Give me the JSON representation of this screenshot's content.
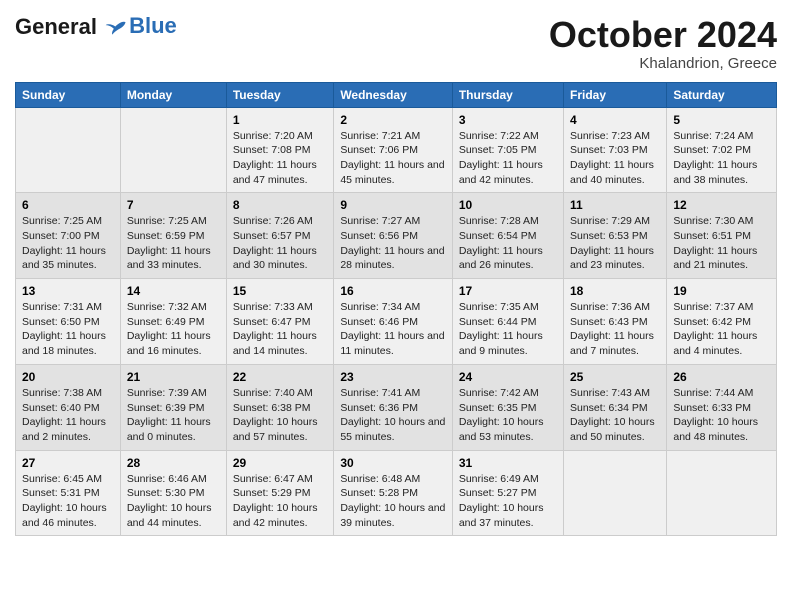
{
  "header": {
    "logo_line1": "General",
    "logo_line2": "Blue",
    "month": "October 2024",
    "location": "Khalandrion, Greece"
  },
  "weekdays": [
    "Sunday",
    "Monday",
    "Tuesday",
    "Wednesday",
    "Thursday",
    "Friday",
    "Saturday"
  ],
  "weeks": [
    [
      {
        "day": "",
        "sunrise": "",
        "sunset": "",
        "daylight": ""
      },
      {
        "day": "",
        "sunrise": "",
        "sunset": "",
        "daylight": ""
      },
      {
        "day": "1",
        "sunrise": "Sunrise: 7:20 AM",
        "sunset": "Sunset: 7:08 PM",
        "daylight": "Daylight: 11 hours and 47 minutes."
      },
      {
        "day": "2",
        "sunrise": "Sunrise: 7:21 AM",
        "sunset": "Sunset: 7:06 PM",
        "daylight": "Daylight: 11 hours and 45 minutes."
      },
      {
        "day": "3",
        "sunrise": "Sunrise: 7:22 AM",
        "sunset": "Sunset: 7:05 PM",
        "daylight": "Daylight: 11 hours and 42 minutes."
      },
      {
        "day": "4",
        "sunrise": "Sunrise: 7:23 AM",
        "sunset": "Sunset: 7:03 PM",
        "daylight": "Daylight: 11 hours and 40 minutes."
      },
      {
        "day": "5",
        "sunrise": "Sunrise: 7:24 AM",
        "sunset": "Sunset: 7:02 PM",
        "daylight": "Daylight: 11 hours and 38 minutes."
      }
    ],
    [
      {
        "day": "6",
        "sunrise": "Sunrise: 7:25 AM",
        "sunset": "Sunset: 7:00 PM",
        "daylight": "Daylight: 11 hours and 35 minutes."
      },
      {
        "day": "7",
        "sunrise": "Sunrise: 7:25 AM",
        "sunset": "Sunset: 6:59 PM",
        "daylight": "Daylight: 11 hours and 33 minutes."
      },
      {
        "day": "8",
        "sunrise": "Sunrise: 7:26 AM",
        "sunset": "Sunset: 6:57 PM",
        "daylight": "Daylight: 11 hours and 30 minutes."
      },
      {
        "day": "9",
        "sunrise": "Sunrise: 7:27 AM",
        "sunset": "Sunset: 6:56 PM",
        "daylight": "Daylight: 11 hours and 28 minutes."
      },
      {
        "day": "10",
        "sunrise": "Sunrise: 7:28 AM",
        "sunset": "Sunset: 6:54 PM",
        "daylight": "Daylight: 11 hours and 26 minutes."
      },
      {
        "day": "11",
        "sunrise": "Sunrise: 7:29 AM",
        "sunset": "Sunset: 6:53 PM",
        "daylight": "Daylight: 11 hours and 23 minutes."
      },
      {
        "day": "12",
        "sunrise": "Sunrise: 7:30 AM",
        "sunset": "Sunset: 6:51 PM",
        "daylight": "Daylight: 11 hours and 21 minutes."
      }
    ],
    [
      {
        "day": "13",
        "sunrise": "Sunrise: 7:31 AM",
        "sunset": "Sunset: 6:50 PM",
        "daylight": "Daylight: 11 hours and 18 minutes."
      },
      {
        "day": "14",
        "sunrise": "Sunrise: 7:32 AM",
        "sunset": "Sunset: 6:49 PM",
        "daylight": "Daylight: 11 hours and 16 minutes."
      },
      {
        "day": "15",
        "sunrise": "Sunrise: 7:33 AM",
        "sunset": "Sunset: 6:47 PM",
        "daylight": "Daylight: 11 hours and 14 minutes."
      },
      {
        "day": "16",
        "sunrise": "Sunrise: 7:34 AM",
        "sunset": "Sunset: 6:46 PM",
        "daylight": "Daylight: 11 hours and 11 minutes."
      },
      {
        "day": "17",
        "sunrise": "Sunrise: 7:35 AM",
        "sunset": "Sunset: 6:44 PM",
        "daylight": "Daylight: 11 hours and 9 minutes."
      },
      {
        "day": "18",
        "sunrise": "Sunrise: 7:36 AM",
        "sunset": "Sunset: 6:43 PM",
        "daylight": "Daylight: 11 hours and 7 minutes."
      },
      {
        "day": "19",
        "sunrise": "Sunrise: 7:37 AM",
        "sunset": "Sunset: 6:42 PM",
        "daylight": "Daylight: 11 hours and 4 minutes."
      }
    ],
    [
      {
        "day": "20",
        "sunrise": "Sunrise: 7:38 AM",
        "sunset": "Sunset: 6:40 PM",
        "daylight": "Daylight: 11 hours and 2 minutes."
      },
      {
        "day": "21",
        "sunrise": "Sunrise: 7:39 AM",
        "sunset": "Sunset: 6:39 PM",
        "daylight": "Daylight: 11 hours and 0 minutes."
      },
      {
        "day": "22",
        "sunrise": "Sunrise: 7:40 AM",
        "sunset": "Sunset: 6:38 PM",
        "daylight": "Daylight: 10 hours and 57 minutes."
      },
      {
        "day": "23",
        "sunrise": "Sunrise: 7:41 AM",
        "sunset": "Sunset: 6:36 PM",
        "daylight": "Daylight: 10 hours and 55 minutes."
      },
      {
        "day": "24",
        "sunrise": "Sunrise: 7:42 AM",
        "sunset": "Sunset: 6:35 PM",
        "daylight": "Daylight: 10 hours and 53 minutes."
      },
      {
        "day": "25",
        "sunrise": "Sunrise: 7:43 AM",
        "sunset": "Sunset: 6:34 PM",
        "daylight": "Daylight: 10 hours and 50 minutes."
      },
      {
        "day": "26",
        "sunrise": "Sunrise: 7:44 AM",
        "sunset": "Sunset: 6:33 PM",
        "daylight": "Daylight: 10 hours and 48 minutes."
      }
    ],
    [
      {
        "day": "27",
        "sunrise": "Sunrise: 6:45 AM",
        "sunset": "Sunset: 5:31 PM",
        "daylight": "Daylight: 10 hours and 46 minutes."
      },
      {
        "day": "28",
        "sunrise": "Sunrise: 6:46 AM",
        "sunset": "Sunset: 5:30 PM",
        "daylight": "Daylight: 10 hours and 44 minutes."
      },
      {
        "day": "29",
        "sunrise": "Sunrise: 6:47 AM",
        "sunset": "Sunset: 5:29 PM",
        "daylight": "Daylight: 10 hours and 42 minutes."
      },
      {
        "day": "30",
        "sunrise": "Sunrise: 6:48 AM",
        "sunset": "Sunset: 5:28 PM",
        "daylight": "Daylight: 10 hours and 39 minutes."
      },
      {
        "day": "31",
        "sunrise": "Sunrise: 6:49 AM",
        "sunset": "Sunset: 5:27 PM",
        "daylight": "Daylight: 10 hours and 37 minutes."
      },
      {
        "day": "",
        "sunrise": "",
        "sunset": "",
        "daylight": ""
      },
      {
        "day": "",
        "sunrise": "",
        "sunset": "",
        "daylight": ""
      }
    ]
  ]
}
